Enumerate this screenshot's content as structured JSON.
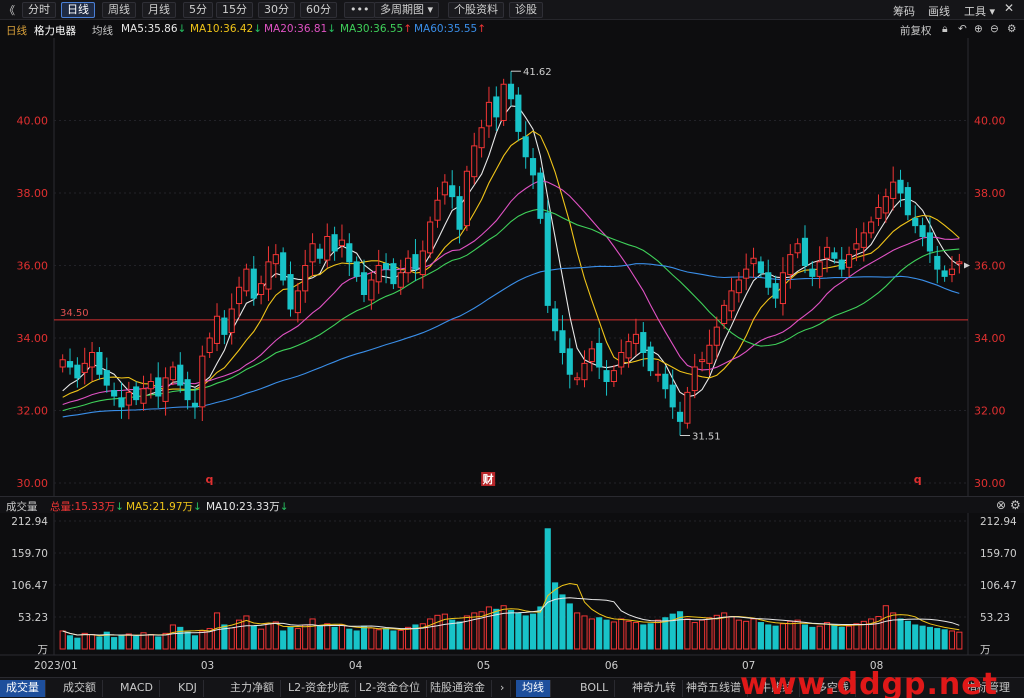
{
  "toolbar": {
    "back_glyph": "《",
    "periods": [
      "分时",
      "日线",
      "周线",
      "月线",
      "5分",
      "15分",
      "30分",
      "60分"
    ],
    "active_period": "日线",
    "more_button": "•••",
    "multi_period": "多周期图",
    "stock_info": "个股资料",
    "diagnose": "诊股",
    "right_items": [
      "筹码",
      "画线",
      "工具"
    ]
  },
  "indicator_bar": {
    "period_label": "日线",
    "stock_name": "格力电器",
    "ma_label": "均线",
    "ma": [
      {
        "label": "MA5:35.86",
        "arrow": "down",
        "color": "#e8e8e8"
      },
      {
        "label": "MA10:36.42",
        "arrow": "down",
        "color": "#f0c419"
      },
      {
        "label": "MA20:36.81",
        "arrow": "down",
        "color": "#e052c4"
      },
      {
        "label": "MA30:36.55",
        "arrow": "up",
        "color": "#3fd15a"
      },
      {
        "label": "MA60:35.55",
        "arrow": "up",
        "color": "#3a8ee8"
      }
    ],
    "adjust": "前复权"
  },
  "price_axis": {
    "ticks": [
      "40.00",
      "38.00",
      "36.00",
      "34.00",
      "32.00",
      "30.00"
    ],
    "reference_line": "34.50",
    "high_label": "41.62",
    "low_label": "31.51",
    "markers": [
      "q",
      "财",
      "q"
    ]
  },
  "volume": {
    "title": "成交量",
    "total": "总量:15.33万",
    "ma5": "MA5:21.97万",
    "ma10": "MA10:23.33万",
    "ticks": [
      "212.94",
      "159.70",
      "106.47",
      "53.23",
      "万"
    ]
  },
  "x_axis": {
    "labels": [
      "2023/01",
      "03",
      "04",
      "05",
      "06",
      "07",
      "08"
    ]
  },
  "bottom_tabs": {
    "left": [
      "成交量",
      "成交额",
      "MACD",
      "KDJ",
      "主力净额",
      "L2-资金抄底",
      "L2-资金仓位",
      "陆股通资金"
    ],
    "right": [
      "均线",
      "BOLL",
      "神奇九转",
      "神奇五线谱",
      "牛熊线",
      "多空线"
    ],
    "manage": "指标管理"
  },
  "watermark": "www.ddgp.net",
  "colors": {
    "up": "#f23535",
    "down": "#18c3c8",
    "ma5": "#e8e8e8",
    "ma10": "#f0c419",
    "ma20": "#e052c4",
    "ma30": "#3fd15a",
    "ma60": "#3a8ee8",
    "axis_text": "#e03030"
  },
  "chart_data": {
    "type": "candlestick",
    "ylim": [
      30,
      42
    ],
    "closes": [
      33.4,
      33.2,
      32.9,
      33.3,
      33.6,
      33.0,
      32.7,
      32.4,
      32.1,
      32.5,
      32.3,
      32.6,
      32.8,
      32.4,
      32.9,
      33.2,
      32.7,
      32.3,
      32.1,
      33.5,
      34.0,
      34.6,
      34.1,
      34.8,
      35.4,
      35.9,
      35.1,
      35.5,
      36.1,
      36.3,
      35.6,
      34.8,
      35.3,
      36.0,
      36.6,
      36.2,
      36.8,
      36.4,
      36.7,
      36.1,
      35.7,
      35.2,
      35.6,
      36.0,
      35.9,
      35.5,
      35.8,
      36.2,
      35.9,
      36.4,
      37.2,
      37.8,
      38.3,
      37.9,
      37.0,
      38.6,
      39.3,
      39.8,
      40.5,
      40.1,
      41.0,
      40.6,
      39.7,
      39.0,
      38.5,
      37.3,
      34.9,
      34.2,
      33.6,
      33.0,
      32.9,
      33.3,
      33.7,
      33.2,
      32.8,
      33.1,
      33.6,
      33.9,
      34.1,
      33.6,
      33.1,
      33.0,
      32.6,
      32.1,
      31.7,
      32.5,
      33.2,
      33.4,
      33.8,
      34.3,
      34.9,
      35.3,
      35.6,
      35.9,
      36.2,
      35.8,
      35.4,
      35.1,
      35.8,
      36.3,
      36.6,
      36.0,
      35.7,
      36.1,
      36.5,
      36.2,
      35.9,
      36.3,
      36.6,
      36.9,
      37.2,
      37.6,
      37.9,
      38.3,
      38.0,
      37.4,
      37.1,
      36.8,
      36.4,
      35.9,
      35.7,
      35.9,
      36.1
    ],
    "volumes": [
      30,
      22,
      18,
      26,
      24,
      20,
      28,
      19,
      23,
      25,
      21,
      27,
      24,
      20,
      26,
      40,
      36,
      28,
      22,
      30,
      34,
      60,
      40,
      35,
      48,
      55,
      38,
      33,
      42,
      45,
      30,
      36,
      34,
      40,
      50,
      38,
      42,
      36,
      40,
      33,
      30,
      38,
      35,
      32,
      34,
      30,
      31,
      36,
      40,
      42,
      50,
      56,
      58,
      48,
      45,
      55,
      60,
      62,
      70,
      66,
      72,
      64,
      60,
      55,
      58,
      70,
      200,
      110,
      90,
      75,
      60,
      55,
      50,
      52,
      48,
      45,
      50,
      46,
      44,
      40,
      42,
      48,
      52,
      58,
      62,
      50,
      44,
      48,
      52,
      56,
      60,
      54,
      48,
      46,
      50,
      44,
      40,
      38,
      42,
      46,
      48,
      40,
      36,
      38,
      44,
      40,
      36,
      38,
      42,
      46,
      50,
      54,
      72,
      60,
      50,
      46,
      40,
      38,
      36,
      34,
      32,
      30,
      28
    ]
  }
}
